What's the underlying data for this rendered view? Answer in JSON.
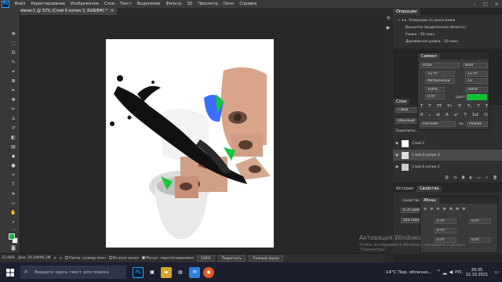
{
  "app": {
    "logo": "Ps",
    "menu": [
      "Файл",
      "Редактирование",
      "Изображение",
      "Слои",
      "Текст",
      "Выделение",
      "Фильтр",
      "3D",
      "Просмотр",
      "Окно",
      "Справка"
    ],
    "doc_tab": "Без имени-1 @ 32% (Слой 6 копия 3, RGB/8#) *",
    "doc_tab_close": "×"
  },
  "colors": {
    "foreground": "#13b83b",
    "background": "#ffffff",
    "accent_green": "#10c030"
  },
  "statusbar": {
    "zoom": "31,98%",
    "doc_info": "Док: 24,1М/96,1М",
    "options": [
      "Настр. размер окон",
      "Во всех окнах",
      "Масшт. перетаскиванием"
    ],
    "zoom_field": "100%",
    "fit_button": "Подогнать",
    "fullscreen_button": "Полный экран"
  },
  "operations_panel": {
    "tab": "Операции",
    "items": [
      "Операции по умолчанию",
      "Виньетка (выделенная область)",
      "Рамка - 50 пикс.",
      "Деревянная рамка - 50 пикс."
    ]
  },
  "character_panel": {
    "tab": "Символ",
    "font": "Огре",
    "style": "Bold",
    "size": "12 пт",
    "leading": "12 пт",
    "kerning": "Метрически",
    "tracking": "13",
    "scale_v": "100%",
    "scale_h": "100%",
    "baseline": "0 пт",
    "color_label": "Цвет:",
    "language": "Русский",
    "aa": "Резкое",
    "aa_mode": "aa"
  },
  "layers_panel": {
    "tabs": [
      "Слои"
    ],
    "filter": "Вид",
    "blend": "Обычные",
    "lock_label": "Закрепить:",
    "layers": [
      {
        "name": "Слой 2",
        "selected": false
      },
      {
        "name": "Слой 6 копия 3",
        "selected": true
      },
      {
        "name": "Слой 6 копия 2",
        "selected": false
      }
    ]
  },
  "history_panel": {
    "tabs": [
      "История",
      "Свойства"
    ]
  },
  "properties_panel": {
    "tab": "Свойства",
    "subtitle": "Свойства текста",
    "width": "6,35 дюйм",
    "height": "446 пикс.",
    "paragraph_tab": "Абзац",
    "indent_fields": [
      "0 пт",
      "0 пт",
      "0 пт",
      "0 пт",
      "0 пт"
    ]
  },
  "watermark": {
    "title": "Активация Windows",
    "text": "Чтобы активировать Windows, перейдите в раздел \"Параметры\"."
  },
  "taskbar": {
    "search_placeholder": "Введите здесь текст для поиска",
    "weather": "14°C  Пер. облачно...",
    "lang": "РУС",
    "time": "20:35",
    "date": "12.10.2021"
  }
}
